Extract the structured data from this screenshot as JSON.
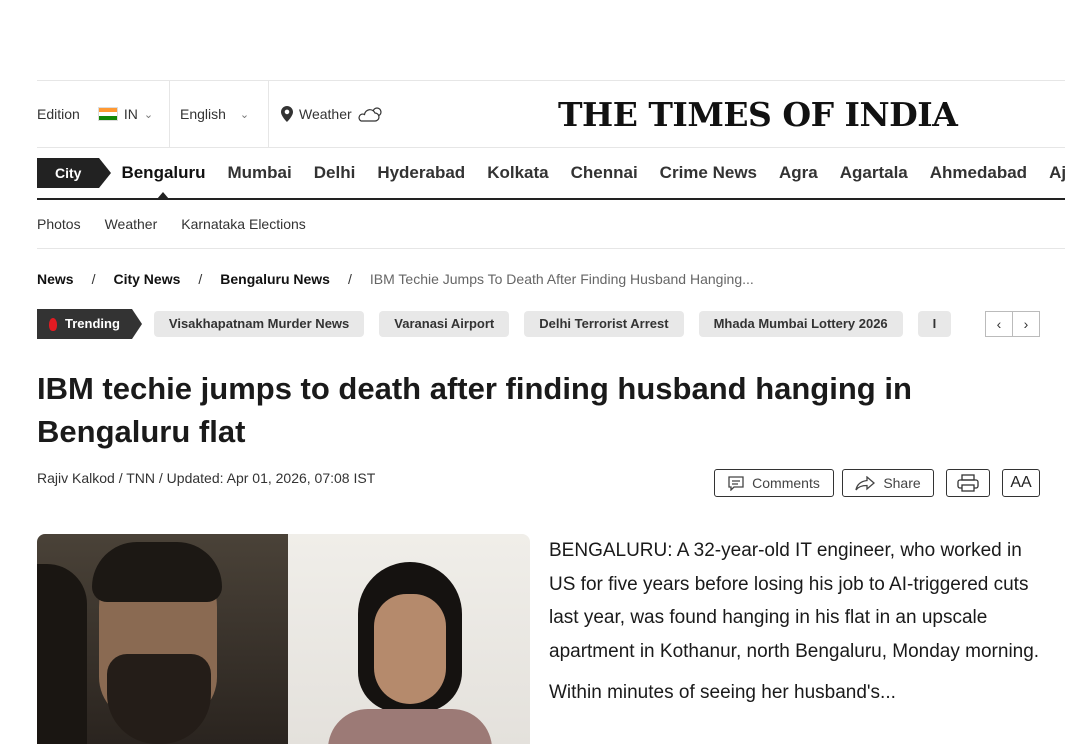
{
  "topbar": {
    "edition_label": "Edition",
    "edition_value": "IN",
    "language": "English",
    "weather_label": "Weather",
    "logo": "THE TIMES OF INDIA"
  },
  "citynav": {
    "city_label": "City",
    "items": [
      "Bengaluru",
      "Mumbai",
      "Delhi",
      "Hyderabad",
      "Kolkata",
      "Chennai",
      "Crime News",
      "Agra",
      "Agartala",
      "Ahmedabad",
      "Ajmer"
    ],
    "active": "Bengaluru"
  },
  "subnav": [
    "Photos",
    "Weather",
    "Karnataka Elections"
  ],
  "breadcrumb": [
    "News",
    "City News",
    "Bengaluru News",
    "IBM Techie Jumps To Death After Finding Husband Hanging..."
  ],
  "trending": {
    "label": "Trending",
    "chips": [
      "Visakhapatnam Murder News",
      "Varanasi Airport",
      "Delhi Terrorist Arrest",
      "Mhada Mumbai Lottery 2026",
      "I"
    ]
  },
  "article": {
    "headline": "IBM techie jumps to death after finding husband hanging in Bengaluru flat",
    "byline": "Rajiv Kalkod / TNN / Updated: Apr 01, 2026, 07:08 IST",
    "comments_label": "Comments",
    "share_label": "Share",
    "text_size_label": "AA",
    "paragraphs": [
      "BENGALURU: A 32-year-old IT engineer, who worked in US for five years before losing his job to AI-triggered cuts last year, was found hanging in his flat in an upscale apartment in Kothanur, north Bengaluru, Monday morning.",
      "Within minutes of seeing her husband's..."
    ]
  },
  "colors": {
    "accent": "#e21b22",
    "dark": "#222222"
  }
}
